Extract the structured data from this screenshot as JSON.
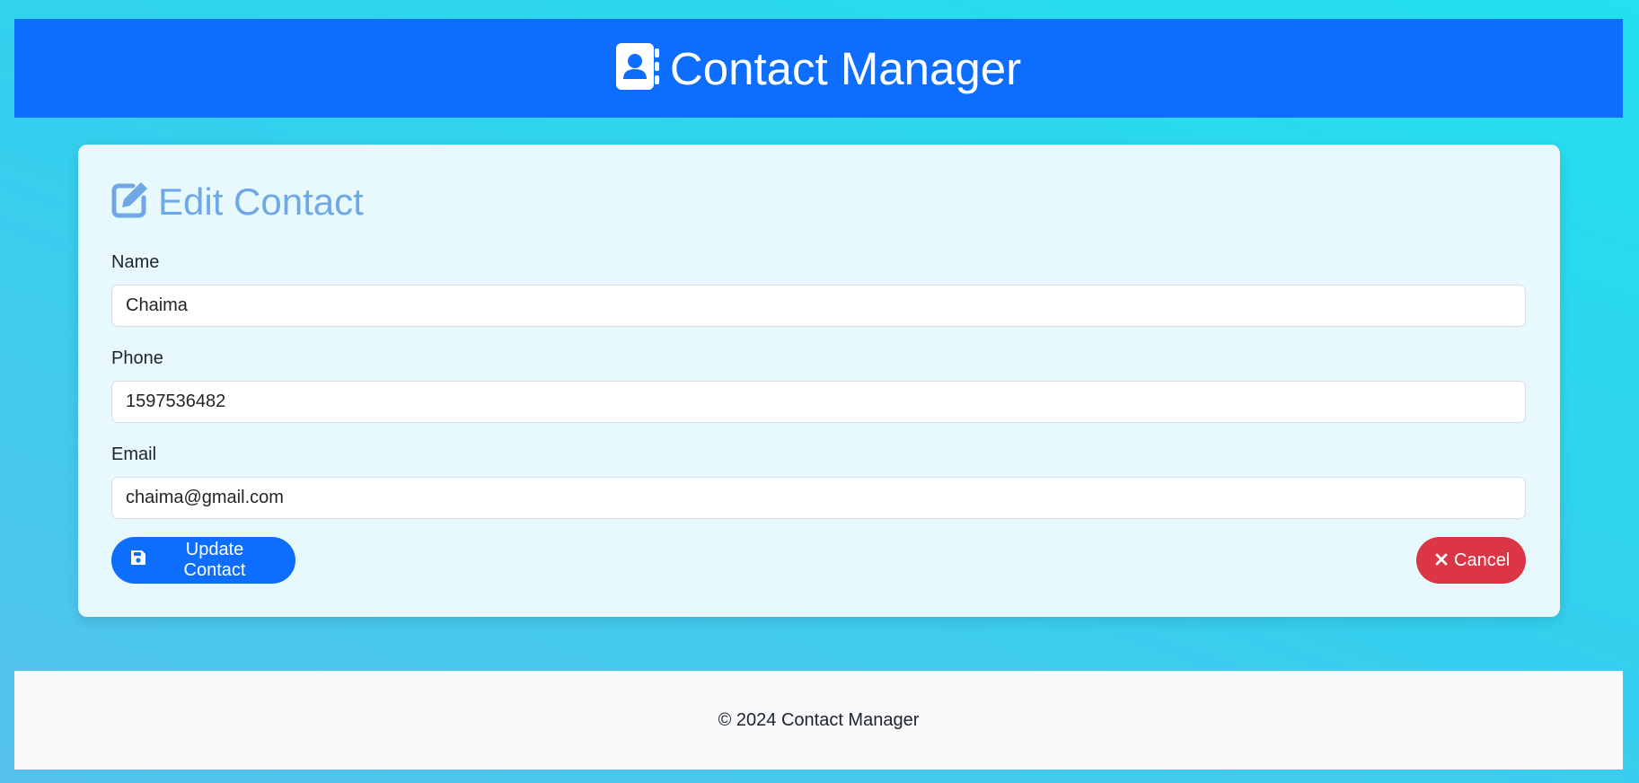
{
  "header": {
    "title": "Contact Manager",
    "icon": "address-book-icon"
  },
  "card": {
    "title": "Edit Contact",
    "title_icon": "edit-icon",
    "fields": {
      "name": {
        "label": "Name",
        "value": "Chaima"
      },
      "phone": {
        "label": "Phone",
        "value": "1597536482"
      },
      "email": {
        "label": "Email",
        "value": "chaima@gmail.com"
      }
    },
    "update_button": {
      "label": "Update Contact",
      "icon": "save-icon"
    },
    "cancel_button": {
      "label": "Cancel",
      "icon": "close-icon"
    }
  },
  "footer": {
    "text": "© 2024 Contact Manager"
  },
  "colors": {
    "primary": "#0d6efd",
    "danger": "#dc3545",
    "title_accent": "#6ea8e6",
    "card_background": "#e8f9fd",
    "footer_background": "#f8f9fa"
  }
}
